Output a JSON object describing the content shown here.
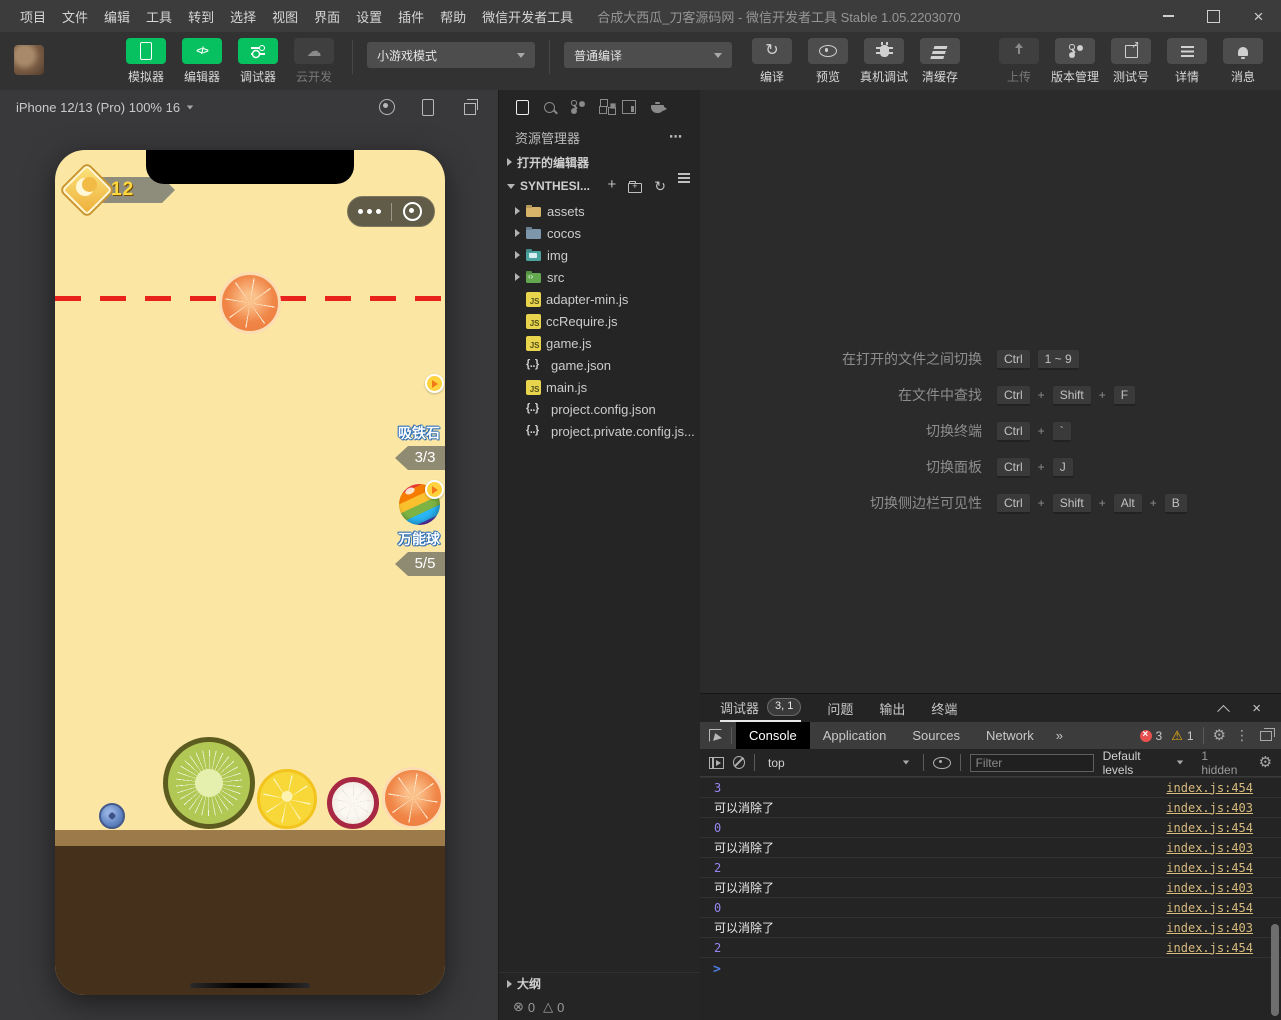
{
  "titlebar": {
    "menus": [
      "项目",
      "文件",
      "编辑",
      "工具",
      "转到",
      "选择",
      "视图",
      "界面",
      "设置",
      "插件",
      "帮助",
      "微信开发者工具"
    ],
    "title": "合成大西瓜_刀客源码网 - 微信开发者工具 Stable 1.05.2203070"
  },
  "toolbar": {
    "nav_buttons": [
      {
        "label": "模拟器",
        "icon": "phone-icon",
        "state": "green"
      },
      {
        "label": "编辑器",
        "icon": "code-icon",
        "state": "green",
        "glyph": "</>"
      },
      {
        "label": "调试器",
        "icon": "sliders-icon",
        "state": "green"
      },
      {
        "label": "云开发",
        "icon": "cloud-icon",
        "state": "disabled",
        "glyph": "☁"
      }
    ],
    "mode_select": {
      "value": "小游戏模式"
    },
    "compile_select": {
      "value": "普通编译"
    },
    "compile_actions": [
      {
        "label": "编译",
        "icon": "refresh-icon",
        "state": "gray",
        "glyph": "↻"
      },
      {
        "label": "预览",
        "icon": "eye-icon",
        "state": "gray"
      },
      {
        "label": "真机调试",
        "icon": "bug-icon",
        "state": "gray"
      },
      {
        "label": "清缓存",
        "icon": "layers-icon",
        "state": "gray",
        "caret": "with-caret"
      }
    ],
    "right_actions": [
      {
        "label": "上传",
        "icon": "upload-icon",
        "state": "disabled"
      },
      {
        "label": "版本管理",
        "icon": "branch-icon",
        "state": "gray"
      },
      {
        "label": "测试号",
        "icon": "external-icon",
        "state": "gray"
      },
      {
        "label": "详情",
        "icon": "menu-lines-icon",
        "state": "gray"
      },
      {
        "label": "消息",
        "icon": "bell-icon",
        "state": "gray"
      }
    ]
  },
  "simulator": {
    "device_label": "iPhone 12/13 (Pro) 100% 16",
    "game": {
      "score": "12",
      "props": [
        {
          "name": "吸铁石",
          "count": "3/3",
          "icon": "magnet-icon",
          "pos": "prop-1"
        },
        {
          "name": "万能球",
          "count": "5/5",
          "icon": "rainbow-ball-icon",
          "pos": "prop-2"
        }
      ],
      "ground_fruits": [
        {
          "name": "blueberry-fruit",
          "cls": "g-blueberry"
        },
        {
          "name": "kiwi-fruit",
          "cls": "g-kiwi"
        },
        {
          "name": "lemon-fruit",
          "cls": "g-lemon"
        },
        {
          "name": "mangosteen-fruit",
          "cls": "g-mangosteen"
        },
        {
          "name": "orange-fruit",
          "cls": "g-orange"
        }
      ]
    }
  },
  "explorer": {
    "panel_title": "资源管理器",
    "more_label": "⋯",
    "open_editors_label": "打开的编辑器",
    "project_label": "SYNTHESI...",
    "tree": [
      {
        "label": "assets",
        "kind": "folder",
        "icon": "folder-yellow-icon"
      },
      {
        "label": "cocos",
        "kind": "folder",
        "icon": "folder-blue-icon"
      },
      {
        "label": "img",
        "kind": "folder",
        "icon": "folder-img-icon"
      },
      {
        "label": "src",
        "kind": "folder",
        "icon": "folder-src-icon"
      },
      {
        "label": "adapter-min.js",
        "kind": "file",
        "icon": "js-icon",
        "glyph": "JS"
      },
      {
        "label": "ccRequire.js",
        "kind": "file",
        "icon": "js-icon",
        "glyph": "JS"
      },
      {
        "label": "game.js",
        "kind": "file",
        "icon": "js-icon",
        "glyph": "JS"
      },
      {
        "label": "game.json",
        "kind": "file",
        "icon": "json-icon",
        "glyph": "{..}"
      },
      {
        "label": "main.js",
        "kind": "file",
        "icon": "js-icon",
        "glyph": "JS"
      },
      {
        "label": "project.config.json",
        "kind": "file",
        "icon": "json-icon",
        "glyph": "{..}"
      },
      {
        "label": "project.private.config.js...",
        "kind": "file",
        "icon": "json-icon",
        "glyph": "{..}"
      }
    ],
    "outline_label": "大纲",
    "problems": {
      "error_icon": "⊗",
      "errors": "0",
      "warning_icon": "△",
      "warnings": "0"
    }
  },
  "editor": {
    "shortcuts": [
      {
        "label": "在打开的文件之间切换",
        "keys": [
          {
            "t": "Ctrl",
            "k": "kbd"
          },
          {
            "t": "1 ~ 9",
            "k": "kbd"
          }
        ]
      },
      {
        "label": "在文件中查找",
        "keys": [
          {
            "t": "Ctrl",
            "k": "kbd"
          },
          {
            "t": "+",
            "k": "sep"
          },
          {
            "t": "Shift",
            "k": "kbd"
          },
          {
            "t": "+",
            "k": "sep"
          },
          {
            "t": "F",
            "k": "kbd"
          }
        ]
      },
      {
        "label": "切换终端",
        "keys": [
          {
            "t": "Ctrl",
            "k": "kbd"
          },
          {
            "t": "+",
            "k": "sep"
          },
          {
            "t": "`",
            "k": "kbd"
          }
        ]
      },
      {
        "label": "切换面板",
        "keys": [
          {
            "t": "Ctrl",
            "k": "kbd"
          },
          {
            "t": "+",
            "k": "sep"
          },
          {
            "t": "J",
            "k": "kbd"
          }
        ]
      },
      {
        "label": "切换侧边栏可见性",
        "keys": [
          {
            "t": "Ctrl",
            "k": "kbd"
          },
          {
            "t": "+",
            "k": "sep"
          },
          {
            "t": "Shift",
            "k": "kbd"
          },
          {
            "t": "+",
            "k": "sep"
          },
          {
            "t": "Alt",
            "k": "kbd"
          },
          {
            "t": "+",
            "k": "sep"
          },
          {
            "t": "B",
            "k": "kbd"
          }
        ]
      }
    ]
  },
  "debugger": {
    "tabs": [
      {
        "label": "调试器",
        "badge": "3, 1",
        "state": "active"
      },
      {
        "label": "问题"
      },
      {
        "label": "输出"
      },
      {
        "label": "终端"
      }
    ],
    "devtools_tabs": [
      {
        "label": "Console",
        "state": "active"
      },
      {
        "label": "Application"
      },
      {
        "label": "Sources"
      },
      {
        "label": "Network"
      }
    ],
    "more_tabs_glyph": "»",
    "counts": {
      "errors": "3",
      "warnings": "1"
    },
    "console_toolbar": {
      "context": "top",
      "filter_placeholder": "Filter",
      "levels": "Default levels",
      "hidden_label": "1 hidden"
    },
    "logs": [
      {
        "text": "3",
        "kind": "number",
        "source": "index.js:454"
      },
      {
        "text": "可以消除了",
        "kind": "text",
        "source": "index.js:403"
      },
      {
        "text": "0",
        "kind": "number",
        "source": "index.js:454"
      },
      {
        "text": "可以消除了",
        "kind": "text",
        "source": "index.js:403"
      },
      {
        "text": "2",
        "kind": "number",
        "source": "index.js:454"
      },
      {
        "text": "可以消除了",
        "kind": "text",
        "source": "index.js:403"
      },
      {
        "text": "0",
        "kind": "number",
        "source": "index.js:454"
      },
      {
        "text": "可以消除了",
        "kind": "text",
        "source": "index.js:403"
      },
      {
        "text": "2",
        "kind": "number",
        "source": "index.js:454"
      }
    ],
    "prompt_glyph": ">"
  },
  "colors": {
    "wechat_green": "#07c160",
    "dashed_line_red": "#e8231d",
    "phone_background": "#fbe7a3",
    "console_link": "#d7ba7d",
    "console_number": "#9486f0"
  }
}
